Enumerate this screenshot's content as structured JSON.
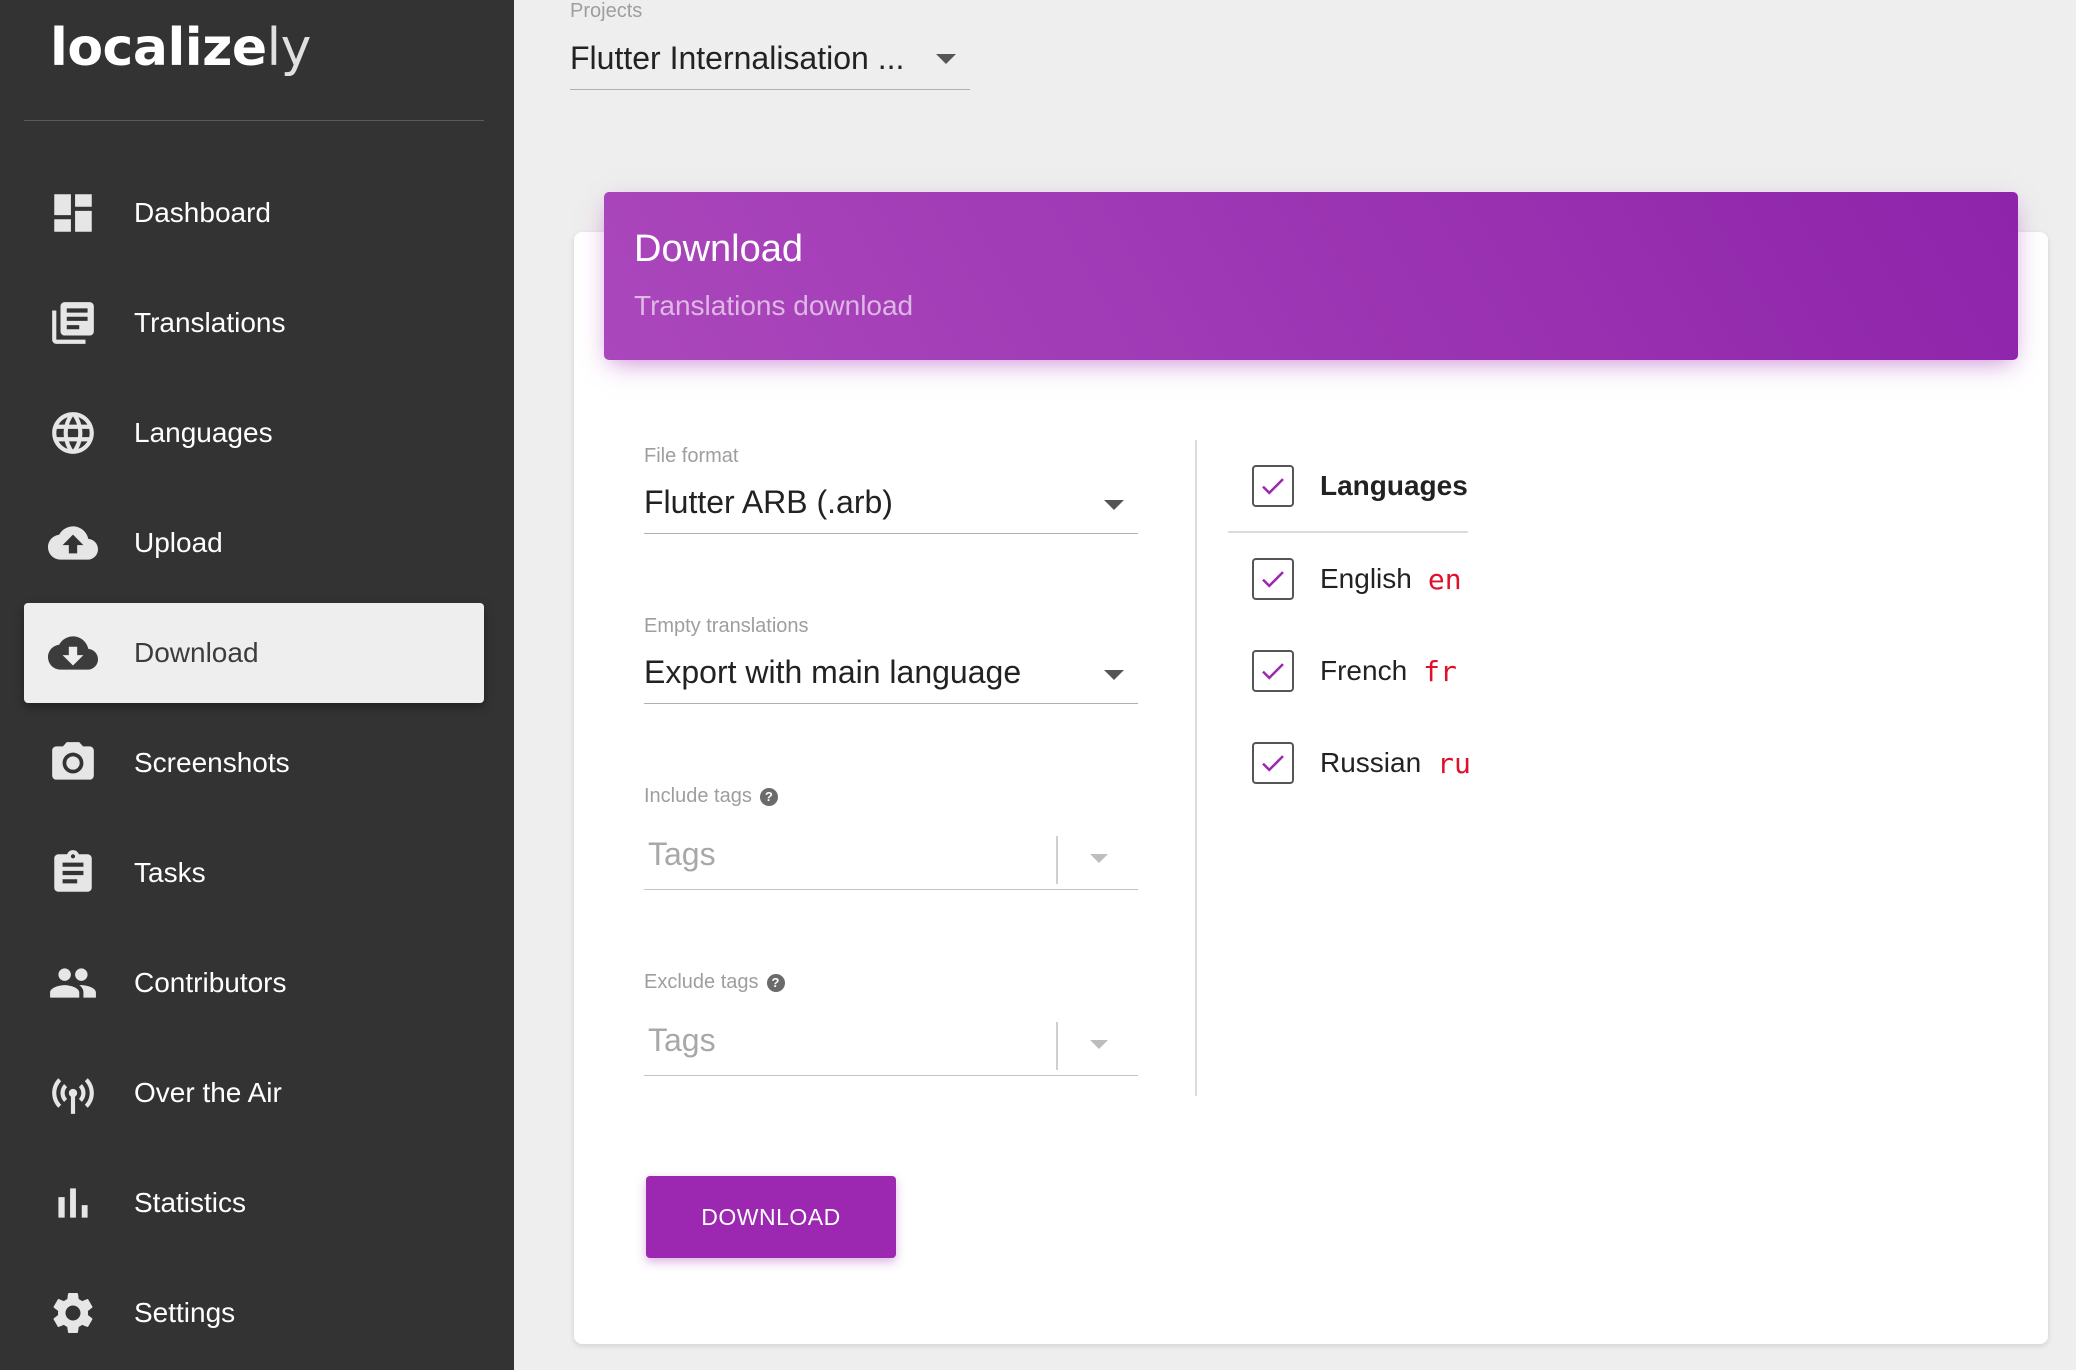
{
  "app": {
    "logo_main": "localize",
    "logo_suffix": "ly"
  },
  "sidebar": {
    "items": [
      {
        "label": "Dashboard",
        "icon": "dashboard-icon"
      },
      {
        "label": "Translations",
        "icon": "translations-icon"
      },
      {
        "label": "Languages",
        "icon": "globe-icon"
      },
      {
        "label": "Upload",
        "icon": "cloud-upload-icon"
      },
      {
        "label": "Download",
        "icon": "cloud-download-icon",
        "active": true
      },
      {
        "label": "Screenshots",
        "icon": "camera-icon"
      },
      {
        "label": "Tasks",
        "icon": "clipboard-icon"
      },
      {
        "label": "Contributors",
        "icon": "people-icon"
      },
      {
        "label": "Over the Air",
        "icon": "antenna-icon"
      },
      {
        "label": "Statistics",
        "icon": "bar-chart-icon"
      },
      {
        "label": "Settings",
        "icon": "gear-icon"
      }
    ]
  },
  "project": {
    "label": "Projects",
    "value": "Flutter Internalisation ..."
  },
  "card": {
    "title": "Download",
    "subtitle": "Translations download"
  },
  "form": {
    "file_format": {
      "label": "File format",
      "value": "Flutter ARB (.arb)"
    },
    "empty_translations": {
      "label": "Empty translations",
      "value": "Export with main language"
    },
    "include_tags": {
      "label": "Include tags",
      "placeholder": "Tags"
    },
    "exclude_tags": {
      "label": "Exclude tags",
      "placeholder": "Tags"
    },
    "download_button": "DOWNLOAD"
  },
  "languages": {
    "header": "Languages",
    "all_checked": true,
    "items": [
      {
        "name": "English",
        "code": "en",
        "checked": true
      },
      {
        "name": "French",
        "code": "fr",
        "checked": true
      },
      {
        "name": "Russian",
        "code": "ru",
        "checked": true
      }
    ]
  },
  "colors": {
    "sidebar_bg": "#333333",
    "accent": "#9c27b0",
    "language_code": "#e0102b",
    "checkmark": "#9c27b0"
  }
}
